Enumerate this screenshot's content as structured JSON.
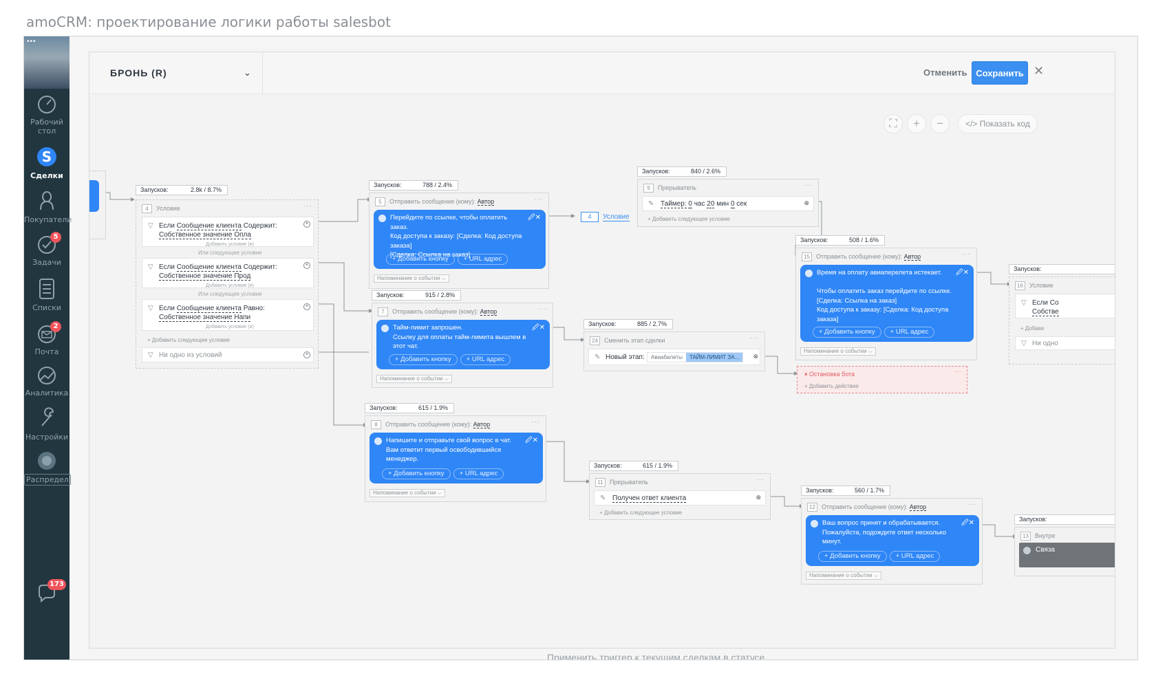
{
  "caption": "amoCRM: проектирование логики работы salesbot",
  "background": {
    "text": "Применить триггер к текущим сделкам в статусе"
  },
  "sidebar": {
    "dots": "•••",
    "items": [
      {
        "label": "Рабочий стол",
        "line1": "Рабочий",
        "line2": "стол",
        "icon": "dashboard-icon"
      },
      {
        "label": "Сделки",
        "icon": "deals-icon"
      },
      {
        "label": "Покупатели",
        "icon": "customers-icon"
      },
      {
        "label": "Задачи",
        "icon": "tasks-icon",
        "badge": "5"
      },
      {
        "label": "Списки",
        "icon": "lists-icon"
      },
      {
        "label": "Почта",
        "icon": "mail-icon",
        "badge": "2"
      },
      {
        "label": "Аналитика",
        "icon": "analytics-icon"
      },
      {
        "label": "Настройки",
        "icon": "settings-icon"
      },
      {
        "label": "Распредел",
        "icon": "distribution-icon"
      }
    ],
    "chat_badge": "173"
  },
  "modal": {
    "trigger_title": "БРОНЬ (R)",
    "cancel_label": "Отменить",
    "save_label": "Сохранить",
    "close_glyph": "✕",
    "show_code_label": "</> Показать код"
  },
  "nodes": {
    "n4": {
      "runs_label": "Запусков:",
      "runs_value": "2.8k / 8.7%",
      "num": "4",
      "type": "Условие",
      "conditions": [
        {
          "prefix": "Если ",
          "field": "Сообщение клиента",
          "op": " Содержит:",
          "value_label": "Собственное значение",
          "value": "Опла",
          "sub": "Добавить условие (и)"
        },
        {
          "prefix": "Если ",
          "field": "Сообщение клиента",
          "op": " Содержит:",
          "value_label": "Собственное значение",
          "value": "Прод",
          "sub": "Добавить условие (и)"
        },
        {
          "prefix": "Если ",
          "field": "Сообщение клиента",
          "op": " Равно:",
          "value_label": "Собственное значение",
          "value": "Напи",
          "sub": "Добавить условие (и)"
        }
      ],
      "or_label": "Или следующее условие",
      "add_label": "+ Добавить следующее условие",
      "none_label": "Ни одно из условий"
    },
    "n5": {
      "runs_label": "Запусков:",
      "runs_value": "788 / 2.4%",
      "num": "5",
      "type": "Отправить сообщение (кому):",
      "to": "Автор",
      "text": "Перейдите по ссылке, чтобы оплатить заказ.\nКод доступа к заказу: [Сделка: Код доступа заказа]\n[Сделка: Ссылка на заказ]",
      "btn_add": "+ Добавить кнопку",
      "btn_url": "+ URL адрес",
      "remind": "Напоминание о событии ⌵"
    },
    "n7": {
      "runs_label": "Запусков:",
      "runs_value": "915 / 2.8%",
      "num": "7",
      "type": "Отправить сообщение (кому):",
      "to": "Автор",
      "text": "Тайм-лимит запрошен.\nСсылку для оплаты тайм-лимита вышлем в этот чат.",
      "btn_add": "+ Добавить кнопку",
      "btn_url": "+ URL адрес",
      "remind": "Напоминание о событии ⌵"
    },
    "n8": {
      "runs_label": "Запусков:",
      "runs_value": "615 / 1.9%",
      "num": "8",
      "type": "Отправить сообщение (кому):",
      "to": "Автор",
      "text": "Напишите и отправьте свой вопрос в чат.\nВам ответит первый освободившийся менеджер.",
      "btn_add": "+ Добавить кнопку",
      "btn_url": "+ URL адрес",
      "remind": "Напоминание о событии ⌵"
    },
    "cond_link": {
      "num": "4",
      "label": "Условие"
    },
    "n9": {
      "runs_label": "Запусков:",
      "runs_value": "840 / 2.6%",
      "num": "9",
      "type": "Прерыватель",
      "timer_label": "Таймер:",
      "h": "0",
      "h_unit": "час",
      "m": "20",
      "m_unit": "мин",
      "s": "0",
      "s_unit": "сек",
      "add_label": "+ Добавить следующее условие"
    },
    "n24": {
      "runs_label": "Запусков:",
      "runs_value": "885 / 2.7%",
      "num": "24",
      "type": "Сменить этап сделки",
      "stage_label": "Новый этап:",
      "pipeline": "Авиабилеты",
      "stage": "ТАЙМ-ЛИМИТ ЗА..."
    },
    "n11": {
      "runs_label": "Запусков:",
      "runs_value": "615 / 1.9%",
      "num": "11",
      "type": "Прерыватель",
      "event": "Получен ответ клиента",
      "add_label": "+ Добавить следующее условие"
    },
    "n15": {
      "runs_label": "Запусков:",
      "runs_value": "508 / 1.6%",
      "num": "15",
      "type": "Отправить сообщение (кому):",
      "to": "Автор",
      "text": "Время на оплату авиаперелета истекает.\n\nЧтобы оплатить заказ перейдите по ссылке. [Сделка: Ссылка на заказ]\nКод доступа к заказу: [Сделка: Код доступа заказа]",
      "btn_add": "+ Добавить кнопку",
      "btn_url": "+ URL адрес",
      "remind": "Напоминание о событии ⌵"
    },
    "stop": {
      "label": "Остановка бота",
      "add": "+ Добавить действие"
    },
    "n12": {
      "runs_label": "Запусков:",
      "runs_value": "560 / 1.7%",
      "num": "12",
      "type": "Отправить сообщение (кому):",
      "to": "Автор",
      "text": "Ваш вопрос принят и обрабатывается.\nПожалуйста, подождите ответ несколько минут.",
      "btn_add": "+ Добавить кнопку",
      "btn_url": "+ URL адрес",
      "remind": "Напоминание о событии ⌵"
    },
    "n16": {
      "runs_label": "Запусков:",
      "num": "16",
      "type": "Условие",
      "cond_text": "Если Со",
      "cond_sub": "Собстве",
      "add_label": "+ Добави",
      "none_label": "Ни одно"
    },
    "n13": {
      "runs_label": "Запусков:",
      "num": "13",
      "type": "Внутре",
      "text": "Связа"
    }
  }
}
